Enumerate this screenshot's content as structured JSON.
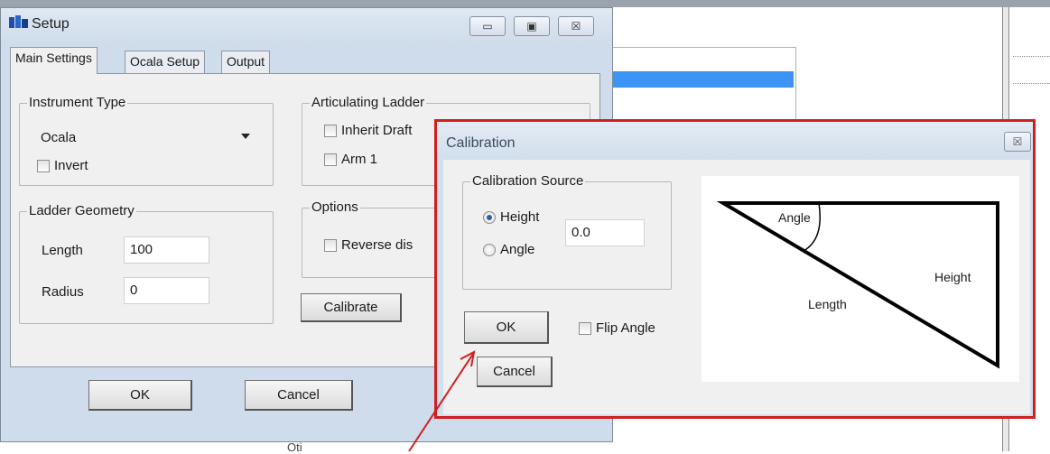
{
  "setup": {
    "title": "Setup",
    "window_buttons": {
      "minimize": "▭",
      "maximize": "▣",
      "close": "☒"
    },
    "tabs": [
      {
        "label": "Main Settings",
        "active": true
      },
      {
        "label": "Ocala Setup",
        "active": false
      },
      {
        "label": "Output",
        "active": false
      }
    ],
    "instrument_type": {
      "legend": "Instrument Type",
      "selected": "Ocala",
      "invert_label": "Invert",
      "invert_checked": false
    },
    "articulating_ladder": {
      "legend": "Articulating Ladder",
      "inherit_draft_label": "Inherit Draft",
      "arm1_label": "Arm 1"
    },
    "ladder_geometry": {
      "legend": "Ladder Geometry",
      "length_label": "Length",
      "length_value": "100",
      "radius_label": "Radius",
      "radius_value": "0"
    },
    "options": {
      "legend": "Options",
      "reverse_label": "Reverse dis"
    },
    "calibrate_label": "Calibrate",
    "ok_label": "OK",
    "cancel_label": "Cancel"
  },
  "calibration": {
    "title": "Calibration",
    "close_glyph": "☒",
    "source": {
      "legend": "Calibration Source",
      "height_label": "Height",
      "angle_label": "Angle",
      "selected": "Height",
      "value": "0.0"
    },
    "ok_label": "OK",
    "cancel_label": "Cancel",
    "flip_angle_label": "Flip Angle",
    "flip_angle_checked": false,
    "diagram": {
      "angle_label": "Angle",
      "height_label": "Height",
      "length_label": "Length"
    }
  },
  "background": {
    "bottom_label": "Oti"
  },
  "colors": {
    "highlight_border": "#d01f1f",
    "selection": "#3d94f6",
    "annotation_arrow": "#d01f1f"
  }
}
